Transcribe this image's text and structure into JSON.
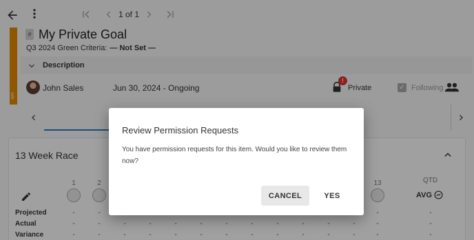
{
  "toolbar": {
    "pager_text": "1 of 1"
  },
  "goal": {
    "kpi_tag": "KPI",
    "hash_label": "#",
    "title": "My Private Goal",
    "criteria_label": "Q3 2024 Green Criteria:",
    "criteria_value": "— Not Set —",
    "description_label": "Description",
    "owner_name": "John Sales",
    "date_range": "Jun 30, 2024 - Ongoing",
    "private_badge": "!",
    "private_label": "Private",
    "following_label": "Following"
  },
  "race": {
    "title": "13 Week Race",
    "week_labels": [
      "1",
      "2",
      "13"
    ],
    "qtd_label": "QTD",
    "avg_label": "AVG",
    "rows": [
      {
        "label": "Projected"
      },
      {
        "label": "Actual"
      },
      {
        "label": "Variance"
      }
    ],
    "cell_value": "-"
  },
  "dialog": {
    "title": "Review Permission Requests",
    "body": "You have permission requests for this item. Would you like to review them now?",
    "cancel_label": "CANCEL",
    "yes_label": "YES"
  },
  "colors": {
    "kpi_strip": "#e08a00",
    "badge": "#dd3333",
    "tab_accent": "#2a7abf"
  },
  "icons": [
    "arrow-back-icon",
    "more-vert-icon",
    "first-page-icon",
    "chevron-left-icon",
    "chevron-right-icon",
    "last-page-icon",
    "chevron-down-icon",
    "lock-icon",
    "checkbox-icon",
    "people-icon",
    "chevron-up-icon",
    "pencil-icon",
    "avg-info-icon"
  ]
}
